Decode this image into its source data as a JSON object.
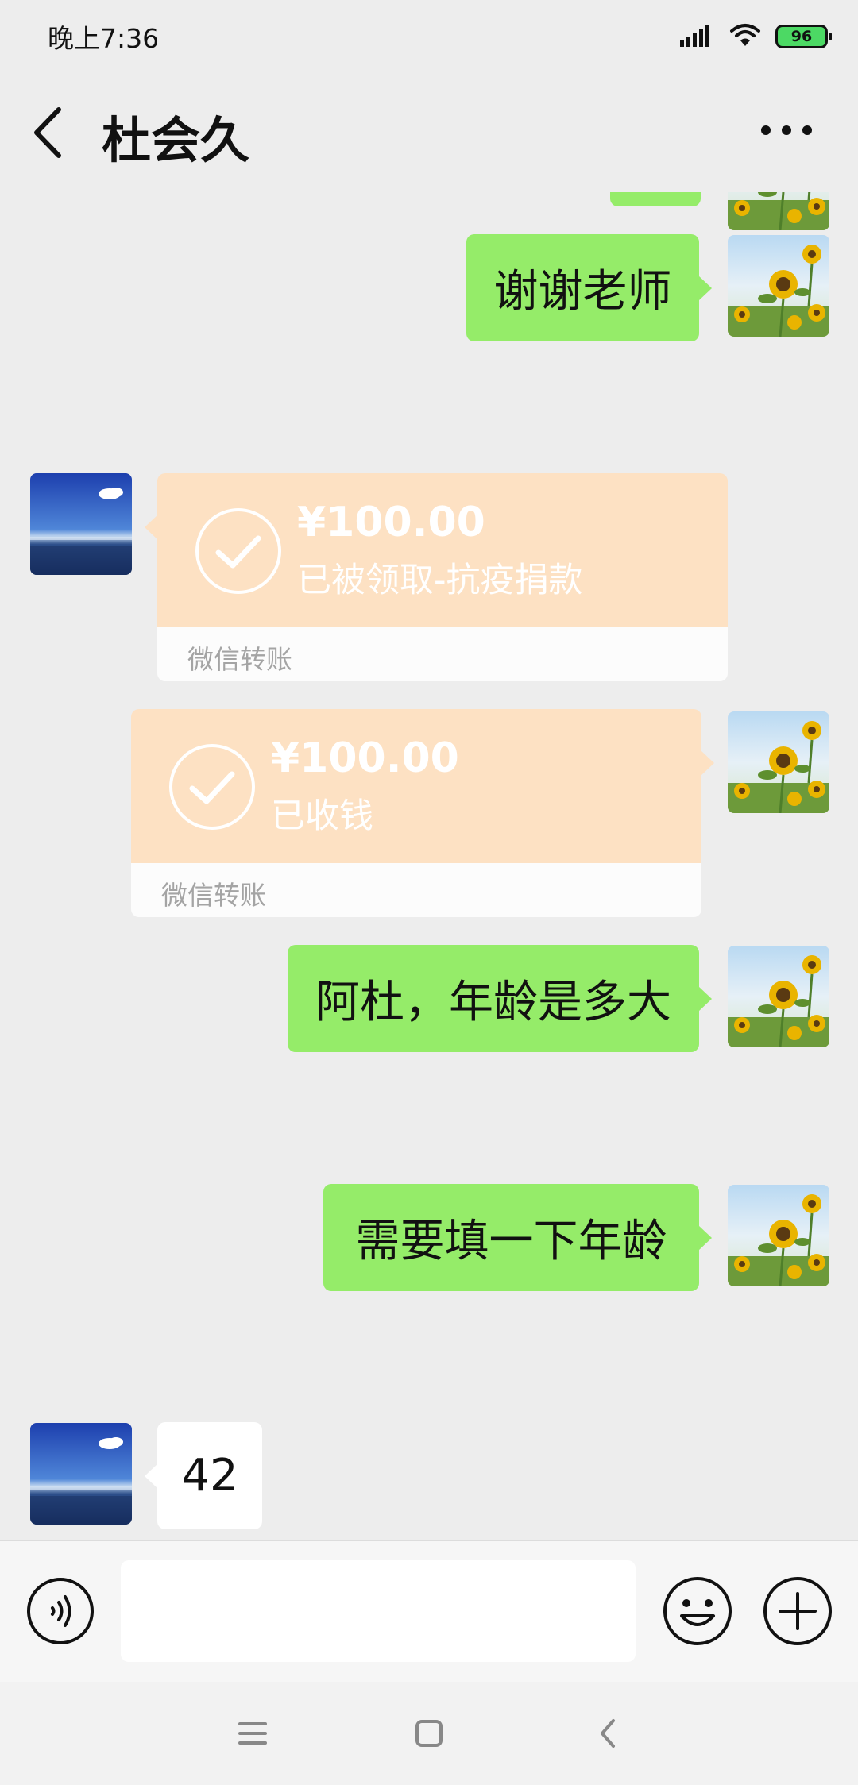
{
  "status_bar": {
    "time": "晚上7:36",
    "battery": "96",
    "icons": [
      "signal-icon",
      "wifi-icon",
      "battery-icon"
    ]
  },
  "header": {
    "title": "杜会久",
    "back_icon": "back-arrow-icon",
    "more_icon": "more-icon"
  },
  "messages": [
    {
      "type": "text",
      "side": "right",
      "text": "谢谢老师"
    },
    {
      "type": "transfer",
      "side": "left",
      "amount": "¥100.00",
      "status": "已被领取-抗疫捐款",
      "footer": "微信转账"
    },
    {
      "type": "transfer",
      "side": "right",
      "amount": "¥100.00",
      "status": "已收钱",
      "footer": "微信转账"
    },
    {
      "type": "text",
      "side": "right",
      "text": "阿杜，年龄是多大"
    },
    {
      "type": "text",
      "side": "right",
      "text": "需要填一下年龄"
    },
    {
      "type": "text",
      "side": "left",
      "text": "42"
    }
  ],
  "input_bar": {
    "placeholder": "",
    "icons": [
      "voice-icon",
      "emoji-icon",
      "plus-icon"
    ]
  },
  "nav_bar": {
    "icons": [
      "menu-icon",
      "home-icon",
      "back-icon"
    ]
  },
  "colors": {
    "background": "#ededed",
    "sent_bubble": "#95ec69",
    "received_bubble": "#ffffff",
    "transfer_card": "#fde1c3"
  }
}
